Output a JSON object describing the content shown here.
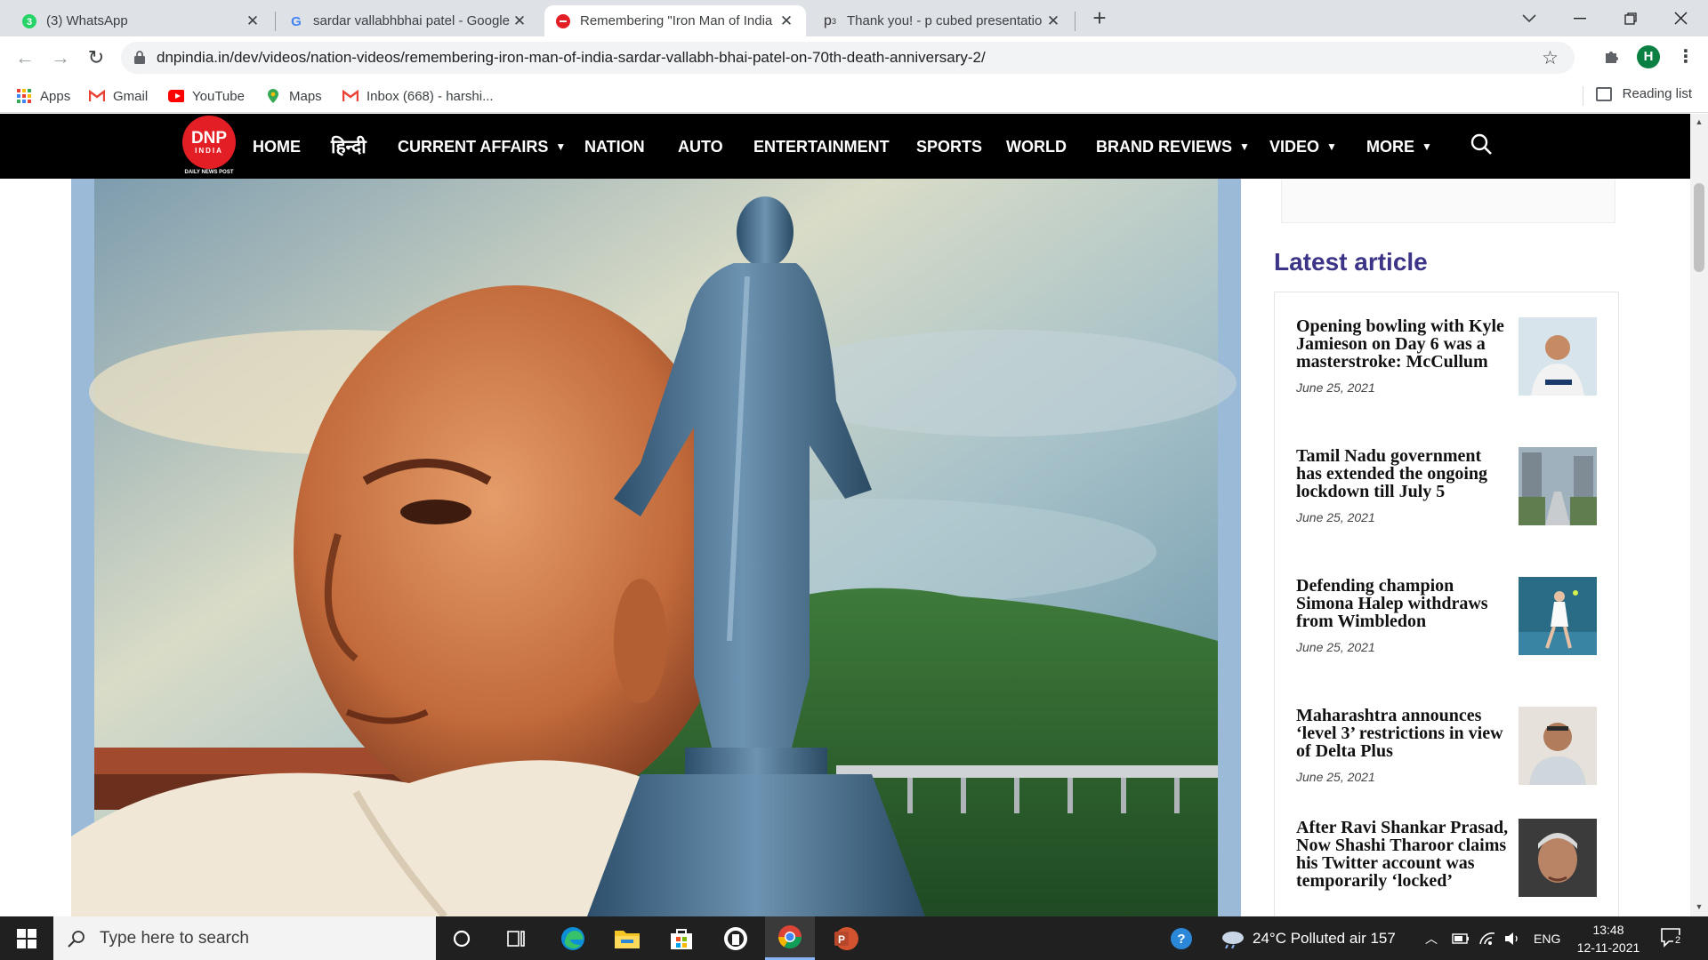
{
  "browser": {
    "tabs": [
      {
        "title": "(3) WhatsApp",
        "badge": "3",
        "active": false
      },
      {
        "title": "sardar vallabhbhai patel - Google",
        "active": false
      },
      {
        "title": "Remembering \"Iron Man of India",
        "active": true
      },
      {
        "title": "Thank you! - p cubed presentatio",
        "favicon_text": "p3",
        "active": false
      }
    ],
    "url": "dnpindia.in/dev/videos/nation-videos/remembering-iron-man-of-india-sardar-vallabh-bhai-patel-on-70th-death-anniversary-2/",
    "profile_initial": "H",
    "bookmarks": [
      {
        "label": "Apps",
        "icon": "apps-grid-icon"
      },
      {
        "label": "Gmail",
        "icon": "gmail-icon"
      },
      {
        "label": "YouTube",
        "icon": "youtube-icon"
      },
      {
        "label": "Maps",
        "icon": "maps-icon"
      },
      {
        "label": "Inbox (668) - harshi...",
        "icon": "gmail-icon"
      }
    ],
    "reading_list": "Reading list"
  },
  "site": {
    "logo": {
      "line1": "DNP",
      "line2": "INDIA",
      "tagline": "DAILY NEWS POST",
      "color": "#e31e24"
    },
    "nav": [
      {
        "label": "HOME",
        "dropdown": false
      },
      {
        "label": "हिन्दी",
        "dropdown": false
      },
      {
        "label": "CURRENT AFFAIRS",
        "dropdown": true
      },
      {
        "label": "NATION",
        "dropdown": false
      },
      {
        "label": "AUTO",
        "dropdown": false
      },
      {
        "label": "ENTERTAINMENT",
        "dropdown": false
      },
      {
        "label": "SPORTS",
        "dropdown": false
      },
      {
        "label": "WORLD",
        "dropdown": false
      },
      {
        "label": "BRAND REVIEWS",
        "dropdown": true
      },
      {
        "label": "VIDEO",
        "dropdown": true
      },
      {
        "label": "MORE",
        "dropdown": true
      }
    ],
    "sidebar": {
      "heading": "Latest article",
      "heading_color": "#3b3487",
      "articles": [
        {
          "title": "Opening bowling with Kyle Jamieson on Day 6 was a masterstroke: McCullum",
          "date": "June 25, 2021",
          "thumb": "cricketer-photo"
        },
        {
          "title": "Tamil Nadu government has extended the ongoing lockdown till July 5",
          "date": "June 25, 2021",
          "thumb": "empty-street-photo"
        },
        {
          "title": "Defending champion Simona Halep withdraws from Wimbledon",
          "date": "June 25, 2021",
          "thumb": "tennis-player-photo"
        },
        {
          "title": "Maharashtra announces ‘level 3’ restrictions in view of Delta Plus",
          "date": "June 25, 2021",
          "thumb": "politician-photo"
        },
        {
          "title": "After Ravi Shankar Prasad, Now Shashi Tharoor claims his Twitter account was temporarily ‘locked’",
          "date": "",
          "thumb": "portrait-photo"
        }
      ]
    }
  },
  "taskbar": {
    "search_placeholder": "Type here to search",
    "weather": "24°C  Polluted air 157",
    "language": "ENG",
    "time": "13:48",
    "date": "12-11-2021",
    "notification_count": "2"
  }
}
